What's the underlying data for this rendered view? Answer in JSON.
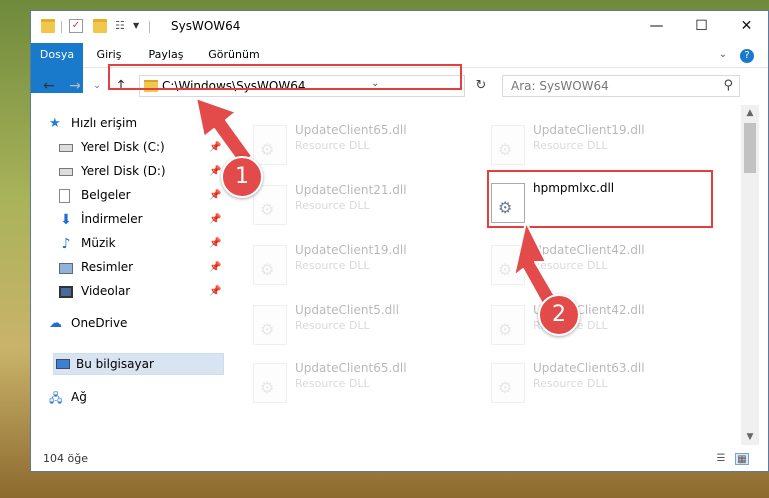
{
  "window": {
    "title": "SysWOW64"
  },
  "ribbon": {
    "tabs": [
      "Dosya",
      "Giriş",
      "Paylaş",
      "Görünüm"
    ]
  },
  "address": {
    "path": "C:\\Windows\\SysWOW64",
    "search_placeholder": "Ara: SysWOW64"
  },
  "sidebar": {
    "quick_access": "Hızlı erişim",
    "items": [
      {
        "label": "Yerel Disk (C:)"
      },
      {
        "label": "Yerel Disk (D:)"
      },
      {
        "label": "Belgeler"
      },
      {
        "label": "İndirmeler"
      },
      {
        "label": "Müzik"
      },
      {
        "label": "Resimler"
      },
      {
        "label": "Videolar"
      }
    ],
    "onedrive": "OneDrive",
    "this_pc": "Bu bilgisayar",
    "network": "Ağ"
  },
  "files": [
    {
      "name": "UpdateClient65.dll",
      "desc": "Resource DLL"
    },
    {
      "name": "UpdateClient19.dll",
      "desc": "Resource DLL"
    },
    {
      "name": "UpdateClient21.dll",
      "desc": "Resource DLL"
    },
    {
      "name": "hpmpmlxc.dll",
      "desc": ""
    },
    {
      "name": "UpdateClient19.dll",
      "desc": "Resource DLL"
    },
    {
      "name": "UpdateClient42.dll",
      "desc": "Resource DLL"
    },
    {
      "name": "UpdateClient5.dll",
      "desc": "Resource DLL"
    },
    {
      "name": "UpdateClient42.dll",
      "desc": "Resource DLL"
    },
    {
      "name": "UpdateClient65.dll",
      "desc": "Resource DLL"
    },
    {
      "name": "UpdateClient63.dll",
      "desc": "Resource DLL"
    }
  ],
  "status": {
    "count": "104 öğe"
  },
  "annotations": {
    "step1": "1",
    "step2": "2",
    "color": "#e34a4a"
  }
}
